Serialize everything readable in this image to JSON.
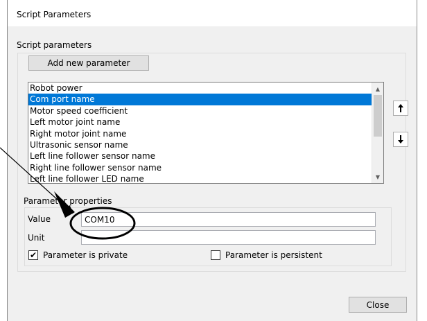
{
  "window": {
    "title": "Script Parameters"
  },
  "script_group": {
    "label": "Script parameters"
  },
  "add_button": {
    "label": "Add new parameter"
  },
  "parameter_list": {
    "items": [
      "Robot power",
      "Com port name",
      "Motor speed coefficient",
      "Left motor joint name",
      "Right motor joint name",
      "Ultrasonic sensor name",
      "Left line follower sensor name",
      "Right line follower sensor name",
      "Left line follower LED name"
    ],
    "selected_index": 1
  },
  "properties": {
    "label": "Parameter properties",
    "value_label": "Value",
    "value": "COM10",
    "unit_label": "Unit",
    "unit": "",
    "private_label": "Parameter is private",
    "private_checked": true,
    "persistent_label": "Parameter is persistent",
    "persistent_checked": false
  },
  "close_button": {
    "label": "Close"
  },
  "icons": {
    "move_up": "arrow-up-icon",
    "move_down": "arrow-down-icon",
    "check": "checkmark-icon"
  }
}
